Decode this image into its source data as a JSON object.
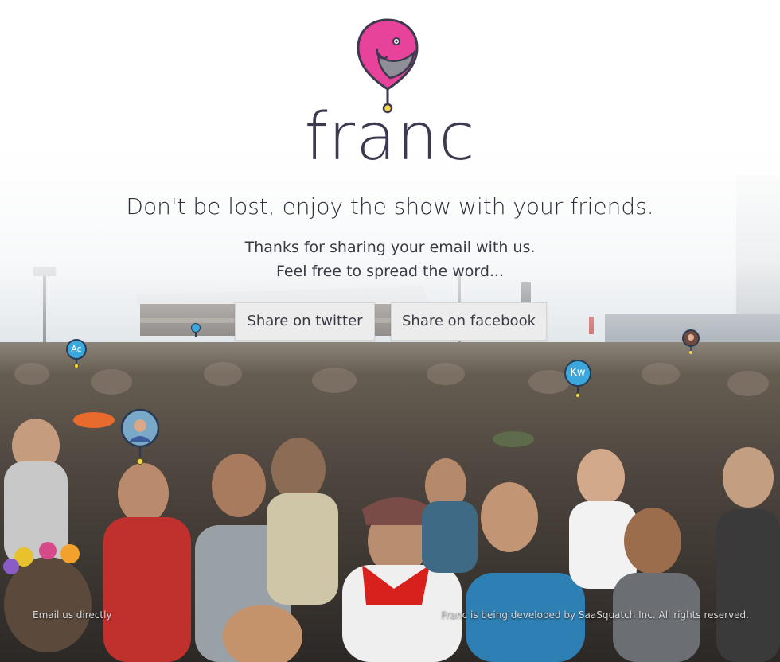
{
  "brand": {
    "name": "franc",
    "logo_colors": {
      "pink": "#e8439a",
      "dark": "#3d3a4f",
      "grey": "#8e8e96",
      "yellow": "#f2d84a"
    }
  },
  "tagline": "Don't be lost, enjoy the show with your friends.",
  "message": {
    "line1": "Thanks for sharing your email with us.",
    "line2": "Feel free to spread the word..."
  },
  "share": {
    "twitter_label": "Share on twitter",
    "facebook_label": "Share on facebook"
  },
  "friend_pins": [
    {
      "initials": "Ac",
      "color": "#3ba7dc"
    },
    {
      "initials": "",
      "color": "#3ba7dc"
    },
    {
      "initials": "Kw",
      "color": "#3ba7dc"
    }
  ],
  "footer": {
    "email_link": "Email us directly",
    "copyright": "Franc is being developed by SaaSquatch Inc. All rights reserved."
  }
}
